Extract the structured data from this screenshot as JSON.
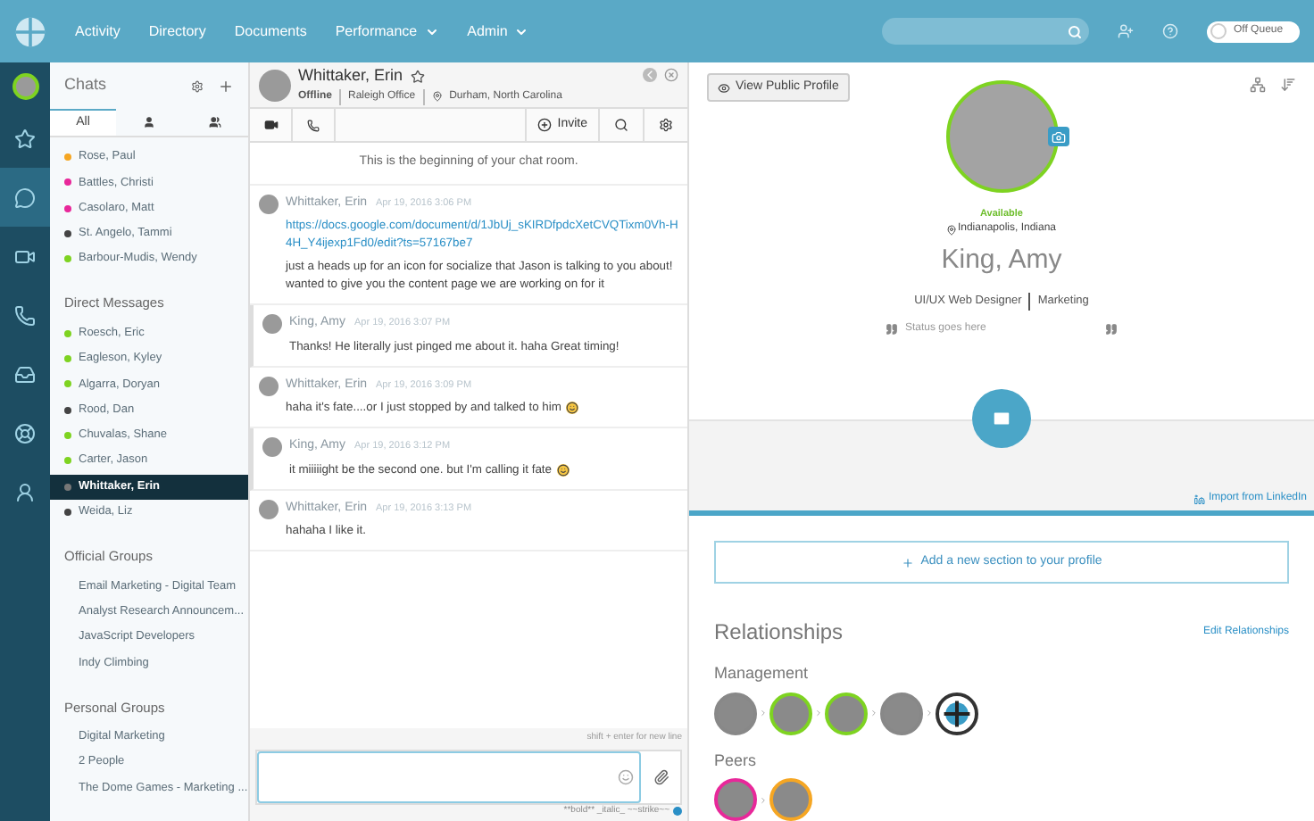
{
  "nav": {
    "items": [
      {
        "label": "Activity",
        "dropdown": false
      },
      {
        "label": "Directory",
        "dropdown": false
      },
      {
        "label": "Documents",
        "dropdown": false
      },
      {
        "label": "Performance",
        "dropdown": true
      },
      {
        "label": "Admin",
        "dropdown": true
      }
    ],
    "queue_toggle": {
      "label": "Off Queue",
      "on": false
    }
  },
  "rail": {
    "items": [
      {
        "selected": false
      },
      {
        "selected": true
      },
      {
        "selected": false
      },
      {
        "selected": false
      },
      {
        "selected": false
      },
      {
        "selected": false
      },
      {
        "selected": false
      }
    ]
  },
  "chats": {
    "title": "Chats",
    "tabs": [
      {
        "kind": "text",
        "label": "All",
        "selected": true
      },
      {
        "kind": "person",
        "selected": false
      },
      {
        "kind": "people",
        "selected": false
      }
    ],
    "sections": [
      {
        "items": [
          {
            "name": "Rose, Paul",
            "color": "#f5a623",
            "selected": false
          },
          {
            "name": "Battles, Christi",
            "color": "#e8289a",
            "selected": false
          },
          {
            "name": "Casolaro, Matt",
            "color": "#e8289a",
            "selected": false
          },
          {
            "name": "St. Angelo, Tammi",
            "color": "#444444",
            "selected": false
          },
          {
            "name": "Barbour-Mudis, Wendy",
            "color": "#7ed321",
            "selected": false
          }
        ]
      },
      {
        "heading": "Direct Messages",
        "items": [
          {
            "name": "Roesch, Eric",
            "color": "#7ed321",
            "selected": false
          },
          {
            "name": "Eagleson, Kyley",
            "color": "#7ed321",
            "selected": false
          },
          {
            "name": "Algarra, Doryan",
            "color": "#7ed321",
            "selected": false
          },
          {
            "name": "Rood, Dan",
            "color": "#444444",
            "selected": false
          },
          {
            "name": "Chuvalas, Shane",
            "color": "#7ed321",
            "selected": false
          },
          {
            "name": "Carter, Jason",
            "color": "#7ed321",
            "selected": false
          },
          {
            "name": "Whittaker, Erin",
            "color": "#777777",
            "selected": true
          },
          {
            "name": "Weida, Liz",
            "color": "#444444",
            "selected": false
          }
        ]
      },
      {
        "heading": "Official Groups",
        "items": [
          {
            "name": "Email Marketing - Digital Team",
            "selected": false
          },
          {
            "name": "Analyst Research Announcem...",
            "selected": false
          },
          {
            "name": "JavaScript Developers",
            "selected": false
          },
          {
            "name": "Indy Climbing",
            "selected": false
          }
        ]
      },
      {
        "heading": "Personal Groups",
        "items": [
          {
            "name": "Digital Marketing",
            "selected": false
          },
          {
            "name": "2 People",
            "selected": false
          },
          {
            "name": "The Dome Games - Marketing ...",
            "selected": false
          }
        ]
      }
    ]
  },
  "chat": {
    "name": "Whittaker, Erin",
    "status": "Offline",
    "office": "Raleigh Office",
    "location": "Durham, North Carolina",
    "invite": "Invite",
    "intro": "This is the beginning of your chat room.",
    "messages": [
      {
        "author": "Whittaker, Erin",
        "time": "Apr 19, 2016 3:06 PM",
        "mine": false,
        "link": "https://docs.google.com/document/d/1JbUj_sKIRDfpdcXetCVQTixm0Vh-H4H_Y4ijexp1Fd0/edit?ts=57167be7",
        "text": "just a heads up for an icon for socialize that Jason is talking to you about! wanted to give you the content page we are working on for it",
        "emoji": false
      },
      {
        "author": "King, Amy",
        "time": "Apr 19, 2016 3:07 PM",
        "mine": true,
        "text": "Thanks! He literally just pinged me about it. haha Great timing!",
        "emoji": false
      },
      {
        "author": "Whittaker, Erin",
        "time": "Apr 19, 2016 3:09 PM",
        "mine": false,
        "text": "haha it's fate....or I just stopped by and talked to him",
        "emoji": true
      },
      {
        "author": "King, Amy",
        "time": "Apr 19, 2016 3:12 PM",
        "mine": true,
        "text": "it miiiiight be the second one. but I'm calling it fate",
        "emoji": true
      },
      {
        "author": "Whittaker, Erin",
        "time": "Apr 19, 2016 3:13 PM",
        "mine": false,
        "text": "hahaha I like it.",
        "emoji": false
      }
    ],
    "hint": "shift + enter for new line",
    "format_hint": "**bold** _italic_ ~~strike~~"
  },
  "profile": {
    "view_button": "View Public Profile",
    "availability": "Available",
    "location": "Indianapolis, Indiana",
    "name": "King, Amy",
    "title": "UI/UX Web Designer",
    "department": "Marketing",
    "status_placeholder": "Status goes here",
    "import": "Import from LinkedIn",
    "add_section": "Add a new section to your profile",
    "relationships": {
      "title": "Relationships",
      "edit": "Edit Relationships",
      "groups": [
        {
          "label": "Management",
          "people": [
            {
              "color": "#888888",
              "kind": "person"
            },
            {
              "color": "#7ed321",
              "kind": "person"
            },
            {
              "color": "#7ed321",
              "kind": "person"
            },
            {
              "color": "#888888",
              "kind": "person"
            },
            {
              "color": "#333333",
              "kind": "logo"
            }
          ]
        },
        {
          "label": "Peers",
          "people": [
            {
              "color": "#e8289a",
              "kind": "person"
            },
            {
              "color": "#f5a623",
              "kind": "person"
            }
          ]
        }
      ]
    }
  }
}
